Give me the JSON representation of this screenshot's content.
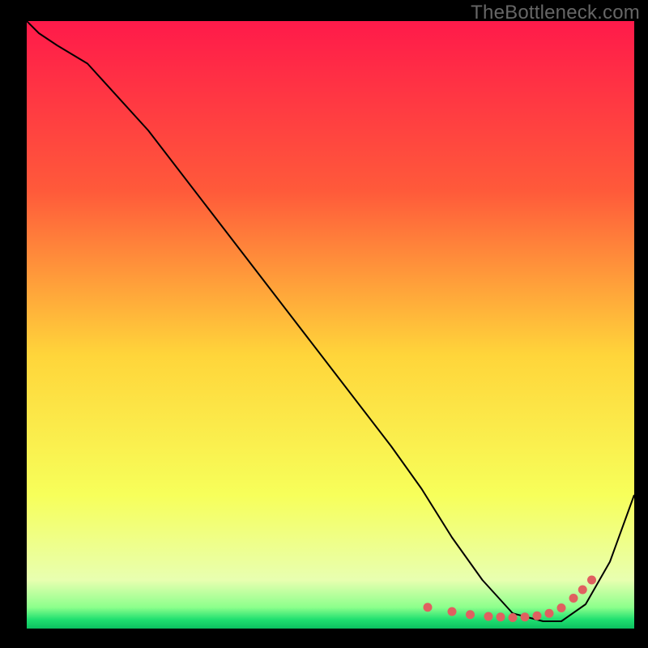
{
  "watermark": "TheBottleneck.com",
  "chart_data": {
    "type": "line",
    "title": "",
    "xlabel": "",
    "ylabel": "",
    "xlim": [
      0,
      100
    ],
    "ylim": [
      0,
      100
    ],
    "series": [
      {
        "name": "curve",
        "x": [
          0,
          2,
          5,
          10,
          20,
          30,
          40,
          50,
          60,
          65,
          70,
          75,
          80,
          85,
          88,
          92,
          96,
          100
        ],
        "y": [
          100,
          98,
          96,
          93,
          82,
          69,
          56,
          43,
          30,
          23,
          15,
          8,
          2.5,
          1.2,
          1.2,
          4,
          11,
          22
        ]
      }
    ],
    "highlight_points": {
      "name": "markers",
      "x": [
        66,
        70,
        73,
        76,
        78,
        80,
        82,
        84,
        86,
        88,
        90,
        91.5,
        93
      ],
      "y": [
        3.5,
        2.8,
        2.3,
        2.0,
        1.9,
        1.8,
        1.9,
        2.1,
        2.5,
        3.4,
        5.0,
        6.4,
        8.0
      ]
    },
    "gradient_stops": [
      {
        "offset": 0.0,
        "color": "#ff1a4a"
      },
      {
        "offset": 0.28,
        "color": "#ff5a3a"
      },
      {
        "offset": 0.55,
        "color": "#ffd53a"
      },
      {
        "offset": 0.78,
        "color": "#f7ff5a"
      },
      {
        "offset": 0.92,
        "color": "#e8ffb0"
      },
      {
        "offset": 0.965,
        "color": "#8cff8c"
      },
      {
        "offset": 0.985,
        "color": "#20e070"
      },
      {
        "offset": 1.0,
        "color": "#0cc060"
      }
    ],
    "marker_color": "#e06060",
    "line_color": "#000000"
  }
}
